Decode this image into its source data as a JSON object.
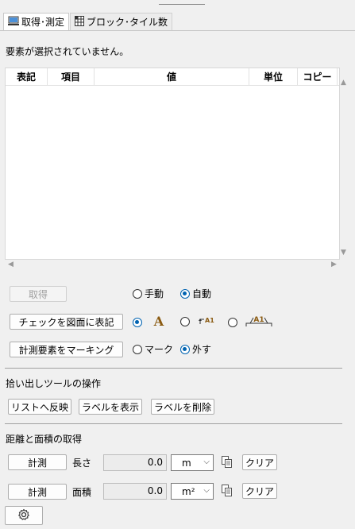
{
  "tabs": [
    {
      "label": "取得･測定",
      "icon": "monitor-icon"
    },
    {
      "label": "ブロック･タイル数",
      "icon": "grid-icon"
    }
  ],
  "status_message": "要素が選択されていません。",
  "table": {
    "columns": [
      "表記",
      "項目",
      "値",
      "単位",
      "コピー"
    ]
  },
  "acquire": {
    "button": "取得",
    "modes": [
      "手動",
      "自動"
    ],
    "selected_mode": "自動"
  },
  "annotate": {
    "button": "チェックを図面に表記",
    "options": [
      "text-A-icon",
      "arrow-A1-icon",
      "bracket-A1-icon"
    ],
    "option_text": [
      "A",
      "A1",
      "A1"
    ],
    "selected_option": "text-A-icon"
  },
  "marking": {
    "button": "計測要素をマーキング",
    "options": [
      "マーク",
      "外す"
    ],
    "selected": "外す"
  },
  "picker_tools": {
    "title": "拾い出しツールの操作",
    "buttons": [
      "リストへ反映",
      "ラベルを表示",
      "ラベルを削除"
    ]
  },
  "distance_area": {
    "title": "距離と面積の取得",
    "rows": [
      {
        "measure_button": "計測",
        "label": "長さ",
        "value": "0.0",
        "unit": "m",
        "clear_button": "クリア"
      },
      {
        "measure_button": "計測",
        "label": "面積",
        "value": "0.0",
        "unit": "m²",
        "clear_button": "クリア"
      }
    ]
  },
  "settings_icon": "gear-icon"
}
